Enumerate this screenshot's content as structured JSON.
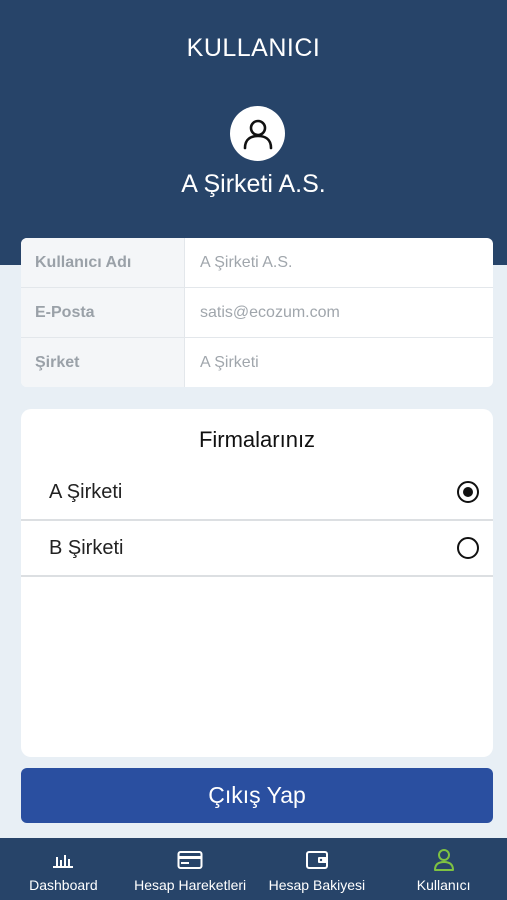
{
  "header": {
    "title": "KULLANICI",
    "user_name": "A Şirketi A.S."
  },
  "info": {
    "rows": [
      {
        "label": "Kullanıcı Adı",
        "value": "A Şirketi A.S."
      },
      {
        "label": "E-Posta",
        "value": "satis@ecozum.com"
      },
      {
        "label": "Şirket",
        "value": "A Şirketi"
      }
    ]
  },
  "firms": {
    "title": "Firmalarınız",
    "items": [
      {
        "name": "A Şirketi",
        "selected": true
      },
      {
        "name": "B Şirketi",
        "selected": false
      }
    ]
  },
  "logout": {
    "label": "Çıkış Yap"
  },
  "tabbar": {
    "items": [
      {
        "label": "Dashboard",
        "icon": "bar-chart-icon"
      },
      {
        "label": "Hesap Hareketleri",
        "icon": "credit-card-icon"
      },
      {
        "label": "Hesap Bakiyesi",
        "icon": "wallet-icon"
      },
      {
        "label": "Kullanıcı",
        "icon": "user-icon",
        "active": true
      }
    ]
  },
  "colors": {
    "header_bg": "#274469",
    "button_bg": "#2a4fa0",
    "active_tab_icon": "#7ec242"
  }
}
